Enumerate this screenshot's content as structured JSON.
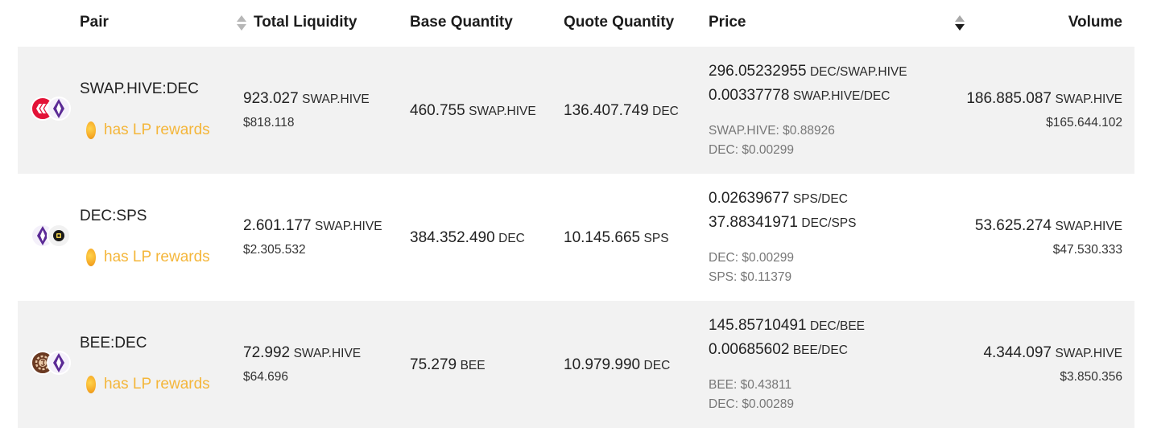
{
  "headers": {
    "pair": "Pair",
    "total_liquidity": "Total Liquidity",
    "base_quantity": "Base Quantity",
    "quote_quantity": "Quote Quantity",
    "price": "Price",
    "volume": "Volume"
  },
  "lp_label": "has LP rewards",
  "rows": [
    {
      "pair": "SWAP.HIVE:DEC",
      "icons": [
        "hive-icon",
        "dec-icon"
      ],
      "liquidity": {
        "value": "923.027",
        "unit": "SWAP.HIVE",
        "usd": "$818.118"
      },
      "base": {
        "value": "460.755",
        "unit": "SWAP.HIVE"
      },
      "quote": {
        "value": "136.407.749",
        "unit": "DEC"
      },
      "price": {
        "p1": "296.05232955",
        "p1_unit": "DEC/SWAP.HIVE",
        "p2": "0.00337778",
        "p2_unit": "SWAP.HIVE/DEC",
        "usd1": "SWAP.HIVE: $0.88926",
        "usd2": "DEC: $0.00299"
      },
      "volume": {
        "value": "186.885.087",
        "unit": "SWAP.HIVE",
        "usd": "$165.644.102"
      }
    },
    {
      "pair": "DEC:SPS",
      "icons": [
        "dec-icon",
        "sps-icon"
      ],
      "liquidity": {
        "value": "2.601.177",
        "unit": "SWAP.HIVE",
        "usd": "$2.305.532"
      },
      "base": {
        "value": "384.352.490",
        "unit": "DEC"
      },
      "quote": {
        "value": "10.145.665",
        "unit": "SPS"
      },
      "price": {
        "p1": "0.02639677",
        "p1_unit": "SPS/DEC",
        "p2": "37.88341971",
        "p2_unit": "DEC/SPS",
        "usd1": "DEC: $0.00299",
        "usd2": "SPS: $0.11379"
      },
      "volume": {
        "value": "53.625.274",
        "unit": "SWAP.HIVE",
        "usd": "$47.530.333"
      }
    },
    {
      "pair": "BEE:DEC",
      "icons": [
        "bee-icon",
        "dec-icon"
      ],
      "liquidity": {
        "value": "72.992",
        "unit": "SWAP.HIVE",
        "usd": "$64.696"
      },
      "base": {
        "value": "75.279",
        "unit": "BEE"
      },
      "quote": {
        "value": "10.979.990",
        "unit": "DEC"
      },
      "price": {
        "p1": "145.85710491",
        "p1_unit": "DEC/BEE",
        "p2": "0.00685602",
        "p2_unit": "BEE/DEC",
        "usd1": "BEE: $0.43811",
        "usd2": "DEC: $0.00289"
      },
      "volume": {
        "value": "4.344.097",
        "unit": "SWAP.HIVE",
        "usd": "$3.850.356"
      }
    }
  ],
  "colors": {
    "row_shade": "#f2f2f2",
    "lp_text": "#f4b63a",
    "hive_red": "#e31337",
    "dec_purple": "#5b2a96",
    "bee_brown": "#6b3a22"
  }
}
